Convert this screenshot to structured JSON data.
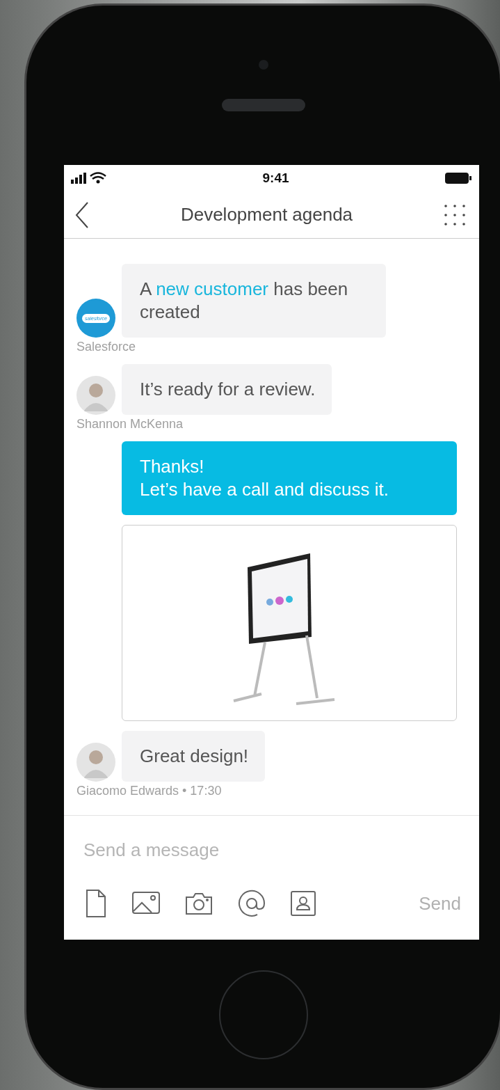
{
  "status_bar": {
    "time": "9:41"
  },
  "header": {
    "title": "Development agenda"
  },
  "messages": [
    {
      "kind": "incoming",
      "avatar": {
        "kind": "logo",
        "text": "salesforce"
      },
      "parts": [
        {
          "kind": "plain",
          "text": "A"
        },
        {
          "kind": "link",
          "text": "new customer"
        },
        {
          "kind": "plain",
          "text": "has been created"
        }
      ],
      "sender": "Salesforce"
    },
    {
      "kind": "incoming",
      "avatar": {
        "kind": "photo"
      },
      "text": "It’s ready for a review.",
      "sender": "Shannon McKenna"
    },
    {
      "kind": "outgoing",
      "text": "Thanks!\nLet’s have a call and discuss it."
    },
    {
      "kind": "image"
    },
    {
      "kind": "incoming",
      "avatar": {
        "kind": "photo"
      },
      "text": "Great design!",
      "sender": "Giacomo Edwards • 17:30"
    }
  ],
  "composer": {
    "placeholder": "Send a message",
    "send": "Send"
  }
}
